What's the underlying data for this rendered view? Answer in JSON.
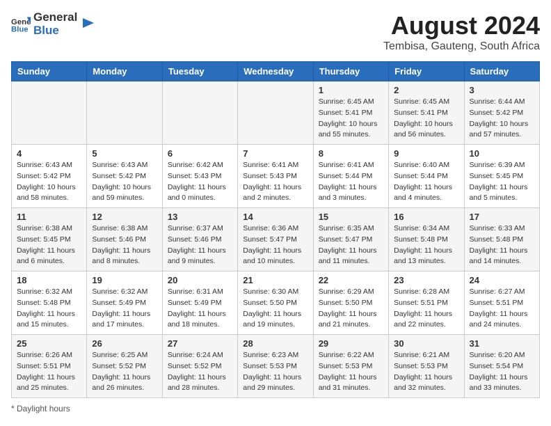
{
  "header": {
    "logo_general": "General",
    "logo_blue": "Blue",
    "title": "August 2024",
    "subtitle": "Tembisa, Gauteng, South Africa"
  },
  "weekdays": [
    "Sunday",
    "Monday",
    "Tuesday",
    "Wednesday",
    "Thursday",
    "Friday",
    "Saturday"
  ],
  "footer": {
    "daylight_label": "Daylight hours"
  },
  "weeks": [
    [
      {
        "day": "",
        "sunrise": "",
        "sunset": "",
        "daylight": ""
      },
      {
        "day": "",
        "sunrise": "",
        "sunset": "",
        "daylight": ""
      },
      {
        "day": "",
        "sunrise": "",
        "sunset": "",
        "daylight": ""
      },
      {
        "day": "",
        "sunrise": "",
        "sunset": "",
        "daylight": ""
      },
      {
        "day": "1",
        "sunrise": "Sunrise: 6:45 AM",
        "sunset": "Sunset: 5:41 PM",
        "daylight": "Daylight: 10 hours and 55 minutes."
      },
      {
        "day": "2",
        "sunrise": "Sunrise: 6:45 AM",
        "sunset": "Sunset: 5:41 PM",
        "daylight": "Daylight: 10 hours and 56 minutes."
      },
      {
        "day": "3",
        "sunrise": "Sunrise: 6:44 AM",
        "sunset": "Sunset: 5:42 PM",
        "daylight": "Daylight: 10 hours and 57 minutes."
      }
    ],
    [
      {
        "day": "4",
        "sunrise": "Sunrise: 6:43 AM",
        "sunset": "Sunset: 5:42 PM",
        "daylight": "Daylight: 10 hours and 58 minutes."
      },
      {
        "day": "5",
        "sunrise": "Sunrise: 6:43 AM",
        "sunset": "Sunset: 5:42 PM",
        "daylight": "Daylight: 10 hours and 59 minutes."
      },
      {
        "day": "6",
        "sunrise": "Sunrise: 6:42 AM",
        "sunset": "Sunset: 5:43 PM",
        "daylight": "Daylight: 11 hours and 0 minutes."
      },
      {
        "day": "7",
        "sunrise": "Sunrise: 6:41 AM",
        "sunset": "Sunset: 5:43 PM",
        "daylight": "Daylight: 11 hours and 2 minutes."
      },
      {
        "day": "8",
        "sunrise": "Sunrise: 6:41 AM",
        "sunset": "Sunset: 5:44 PM",
        "daylight": "Daylight: 11 hours and 3 minutes."
      },
      {
        "day": "9",
        "sunrise": "Sunrise: 6:40 AM",
        "sunset": "Sunset: 5:44 PM",
        "daylight": "Daylight: 11 hours and 4 minutes."
      },
      {
        "day": "10",
        "sunrise": "Sunrise: 6:39 AM",
        "sunset": "Sunset: 5:45 PM",
        "daylight": "Daylight: 11 hours and 5 minutes."
      }
    ],
    [
      {
        "day": "11",
        "sunrise": "Sunrise: 6:38 AM",
        "sunset": "Sunset: 5:45 PM",
        "daylight": "Daylight: 11 hours and 6 minutes."
      },
      {
        "day": "12",
        "sunrise": "Sunrise: 6:38 AM",
        "sunset": "Sunset: 5:46 PM",
        "daylight": "Daylight: 11 hours and 8 minutes."
      },
      {
        "day": "13",
        "sunrise": "Sunrise: 6:37 AM",
        "sunset": "Sunset: 5:46 PM",
        "daylight": "Daylight: 11 hours and 9 minutes."
      },
      {
        "day": "14",
        "sunrise": "Sunrise: 6:36 AM",
        "sunset": "Sunset: 5:47 PM",
        "daylight": "Daylight: 11 hours and 10 minutes."
      },
      {
        "day": "15",
        "sunrise": "Sunrise: 6:35 AM",
        "sunset": "Sunset: 5:47 PM",
        "daylight": "Daylight: 11 hours and 11 minutes."
      },
      {
        "day": "16",
        "sunrise": "Sunrise: 6:34 AM",
        "sunset": "Sunset: 5:48 PM",
        "daylight": "Daylight: 11 hours and 13 minutes."
      },
      {
        "day": "17",
        "sunrise": "Sunrise: 6:33 AM",
        "sunset": "Sunset: 5:48 PM",
        "daylight": "Daylight: 11 hours and 14 minutes."
      }
    ],
    [
      {
        "day": "18",
        "sunrise": "Sunrise: 6:32 AM",
        "sunset": "Sunset: 5:48 PM",
        "daylight": "Daylight: 11 hours and 15 minutes."
      },
      {
        "day": "19",
        "sunrise": "Sunrise: 6:32 AM",
        "sunset": "Sunset: 5:49 PM",
        "daylight": "Daylight: 11 hours and 17 minutes."
      },
      {
        "day": "20",
        "sunrise": "Sunrise: 6:31 AM",
        "sunset": "Sunset: 5:49 PM",
        "daylight": "Daylight: 11 hours and 18 minutes."
      },
      {
        "day": "21",
        "sunrise": "Sunrise: 6:30 AM",
        "sunset": "Sunset: 5:50 PM",
        "daylight": "Daylight: 11 hours and 19 minutes."
      },
      {
        "day": "22",
        "sunrise": "Sunrise: 6:29 AM",
        "sunset": "Sunset: 5:50 PM",
        "daylight": "Daylight: 11 hours and 21 minutes."
      },
      {
        "day": "23",
        "sunrise": "Sunrise: 6:28 AM",
        "sunset": "Sunset: 5:51 PM",
        "daylight": "Daylight: 11 hours and 22 minutes."
      },
      {
        "day": "24",
        "sunrise": "Sunrise: 6:27 AM",
        "sunset": "Sunset: 5:51 PM",
        "daylight": "Daylight: 11 hours and 24 minutes."
      }
    ],
    [
      {
        "day": "25",
        "sunrise": "Sunrise: 6:26 AM",
        "sunset": "Sunset: 5:51 PM",
        "daylight": "Daylight: 11 hours and 25 minutes."
      },
      {
        "day": "26",
        "sunrise": "Sunrise: 6:25 AM",
        "sunset": "Sunset: 5:52 PM",
        "daylight": "Daylight: 11 hours and 26 minutes."
      },
      {
        "day": "27",
        "sunrise": "Sunrise: 6:24 AM",
        "sunset": "Sunset: 5:52 PM",
        "daylight": "Daylight: 11 hours and 28 minutes."
      },
      {
        "day": "28",
        "sunrise": "Sunrise: 6:23 AM",
        "sunset": "Sunset: 5:53 PM",
        "daylight": "Daylight: 11 hours and 29 minutes."
      },
      {
        "day": "29",
        "sunrise": "Sunrise: 6:22 AM",
        "sunset": "Sunset: 5:53 PM",
        "daylight": "Daylight: 11 hours and 31 minutes."
      },
      {
        "day": "30",
        "sunrise": "Sunrise: 6:21 AM",
        "sunset": "Sunset: 5:53 PM",
        "daylight": "Daylight: 11 hours and 32 minutes."
      },
      {
        "day": "31",
        "sunrise": "Sunrise: 6:20 AM",
        "sunset": "Sunset: 5:54 PM",
        "daylight": "Daylight: 11 hours and 33 minutes."
      }
    ]
  ]
}
